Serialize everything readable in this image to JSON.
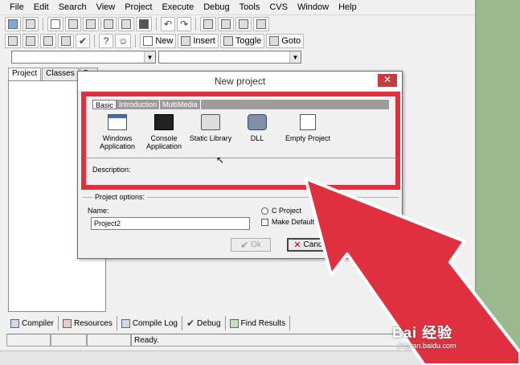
{
  "menu": [
    "File",
    "Edit",
    "Search",
    "View",
    "Project",
    "Execute",
    "Debug",
    "Tools",
    "CVS",
    "Window",
    "Help"
  ],
  "toolbar2": {
    "new": "New",
    "insert": "Insert",
    "toggle": "Toggle",
    "goto": "Goto"
  },
  "left_tabs": [
    "Project",
    "Classes",
    "De"
  ],
  "bottom_tabs": [
    "Compiler",
    "Resources",
    "Compile Log",
    "Debug",
    "Find Results"
  ],
  "status": {
    "text": "Ready."
  },
  "dialog": {
    "title": "New project",
    "close": "✕",
    "category_tabs": [
      "Basic",
      "Introduction",
      "MultiMedia"
    ],
    "templates": [
      {
        "line1": "Windows",
        "line2": "Application",
        "icon": "windows-app-icon"
      },
      {
        "line1": "Console",
        "line2": "Application",
        "icon": "console-app-icon"
      },
      {
        "line1": "Static Library",
        "line2": "",
        "icon": "static-library-icon"
      },
      {
        "line1": "DLL",
        "line2": "",
        "icon": "dll-icon"
      },
      {
        "line1": "Empty Project",
        "line2": "",
        "icon": "empty-project-icon"
      }
    ],
    "description_label": "Description:",
    "project_options_label": "Project options:",
    "name_label": "Name:",
    "name_value": "Project2",
    "c_project": "C Project",
    "make_default": "Make Default Lang",
    "ok": "Ok",
    "cancel": "Cancel"
  },
  "watermark": {
    "main": "Bai 经验",
    "sub": "jingyan.baidu.com"
  },
  "colors": {
    "highlight_red": "#e0303f",
    "arrow_red": "#e0303f",
    "background_green": "#9cb88f"
  }
}
